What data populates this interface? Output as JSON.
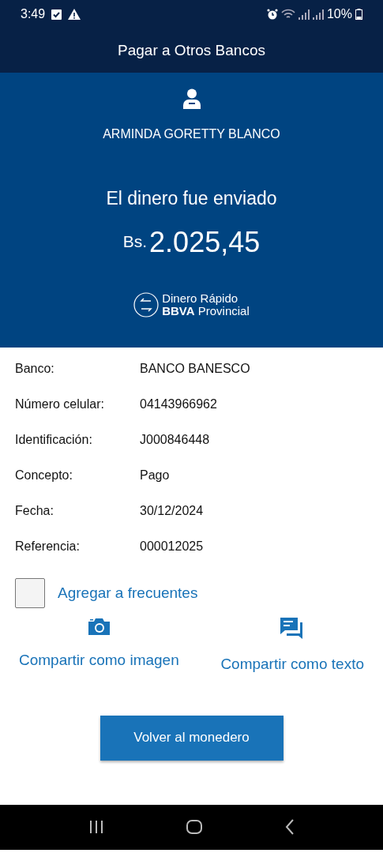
{
  "status_bar": {
    "time": "3:49",
    "battery": "10%"
  },
  "header": {
    "title": "Pagar a Otros Bancos"
  },
  "receipt": {
    "recipient": "ARMINDA GORETTY BLANCO",
    "message": "El dinero fue enviado",
    "currency": "Bs.",
    "amount": "2.025,45",
    "logo_line_1": "Dinero Rápido",
    "logo_line_2": "**BBVA** Provincial"
  },
  "details": [
    {
      "label": "Banco:",
      "value": "BANCO BANESCO"
    },
    {
      "label": "Número celular:",
      "value": "04143966962"
    },
    {
      "label": "Identificación:",
      "value": "J000846448"
    },
    {
      "label": "Concepto:",
      "value": "Pago"
    },
    {
      "label": "Fecha:",
      "value": "30/12/2024"
    },
    {
      "label": "Referencia:",
      "value": "000012025"
    }
  ],
  "favorite": {
    "label": "Agregar a frecuentes",
    "checked": false
  },
  "share": [
    {
      "kind": "camera",
      "label": "Compartir como imagen"
    },
    {
      "kind": "chat",
      "label": "Compartir como texto"
    }
  ],
  "button": {
    "label": "Volver al monedero"
  }
}
